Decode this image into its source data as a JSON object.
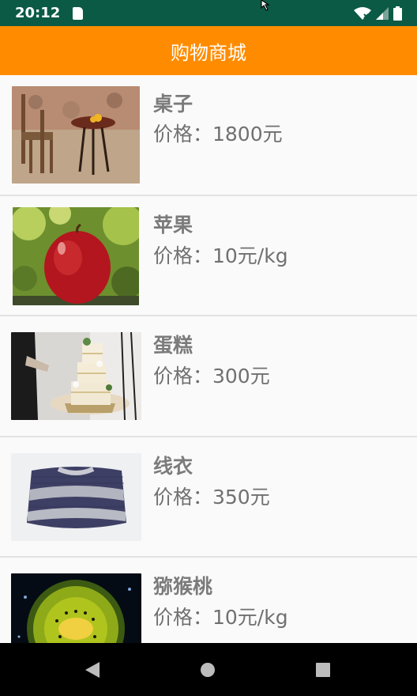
{
  "status_bar": {
    "time": "20:12"
  },
  "app_bar": {
    "title": "购物商城"
  },
  "products": [
    {
      "name": "桌子",
      "price": "价格：1800元",
      "image": "table-chair-photo"
    },
    {
      "name": "苹果",
      "price": "价格：10元/kg",
      "image": "apple-photo"
    },
    {
      "name": "蛋糕",
      "price": "价格：300元",
      "image": "wedding-cake-photo"
    },
    {
      "name": "线衣",
      "price": "价格：350元",
      "image": "sweater-photo"
    },
    {
      "name": "猕猴桃",
      "price": "价格：10元/kg",
      "image": "kiwi-photo"
    }
  ],
  "icons": {
    "sd_card": "sd-card-icon",
    "wifi": "wifi-icon",
    "signal": "signal-icon",
    "battery": "battery-icon",
    "cursor": "cursor-icon",
    "nav_back": "back-triangle-icon",
    "nav_home": "home-circle-icon",
    "nav_recents": "recents-square-icon"
  },
  "colors": {
    "status_bar": "#0b5a45",
    "app_bar": "#ff8c00",
    "background": "#fafafa",
    "divider": "#e2e2e2",
    "nav_bar": "#000000"
  }
}
